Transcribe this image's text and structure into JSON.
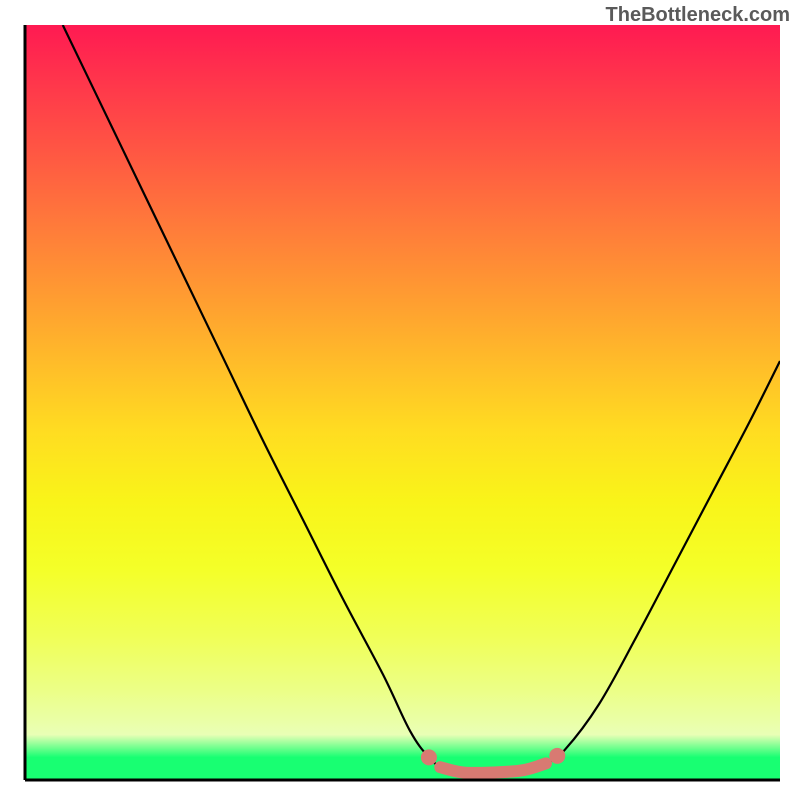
{
  "attribution": "TheBottleneck.com",
  "chart_data": {
    "type": "line",
    "title": "",
    "xlabel": "",
    "ylabel": "",
    "xlim": [
      0,
      100
    ],
    "ylim": [
      0,
      100
    ],
    "series": [
      {
        "name": "bottleneck-curve",
        "points": [
          {
            "x": 5.0,
            "y": 100.0
          },
          {
            "x": 10.3,
            "y": 89.0
          },
          {
            "x": 15.6,
            "y": 78.0
          },
          {
            "x": 20.9,
            "y": 67.0
          },
          {
            "x": 26.2,
            "y": 56.0
          },
          {
            "x": 31.5,
            "y": 45.0
          },
          {
            "x": 36.8,
            "y": 34.5
          },
          {
            "x": 42.1,
            "y": 24.0
          },
          {
            "x": 47.4,
            "y": 14.0
          },
          {
            "x": 51.0,
            "y": 6.5
          },
          {
            "x": 53.5,
            "y": 3.0
          },
          {
            "x": 55.5,
            "y": 1.5
          },
          {
            "x": 58.0,
            "y": 1.0
          },
          {
            "x": 62.0,
            "y": 1.0
          },
          {
            "x": 66.0,
            "y": 1.3
          },
          {
            "x": 69.0,
            "y": 2.2
          },
          {
            "x": 71.5,
            "y": 4.0
          },
          {
            "x": 76.0,
            "y": 10.0
          },
          {
            "x": 81.0,
            "y": 19.0
          },
          {
            "x": 86.0,
            "y": 28.5
          },
          {
            "x": 91.0,
            "y": 38.0
          },
          {
            "x": 96.0,
            "y": 47.5
          },
          {
            "x": 100.0,
            "y": 55.5
          }
        ]
      },
      {
        "name": "sweet-spot-marker",
        "color": "#d87a72",
        "type": "scatter-line",
        "marker_points": [
          {
            "x": 53.5,
            "y": 3.0
          },
          {
            "x": 70.5,
            "y": 3.2
          }
        ],
        "thick_segment": [
          {
            "x": 55.0,
            "y": 1.7
          },
          {
            "x": 58.0,
            "y": 1.0
          },
          {
            "x": 62.0,
            "y": 1.0
          },
          {
            "x": 66.0,
            "y": 1.3
          },
          {
            "x": 69.0,
            "y": 2.2
          }
        ]
      }
    ],
    "axes": {
      "left": {
        "from": [
          25,
          25
        ],
        "to": [
          25,
          780
        ]
      },
      "bottom": {
        "from": [
          25,
          780
        ],
        "to": [
          780,
          780
        ]
      }
    }
  }
}
